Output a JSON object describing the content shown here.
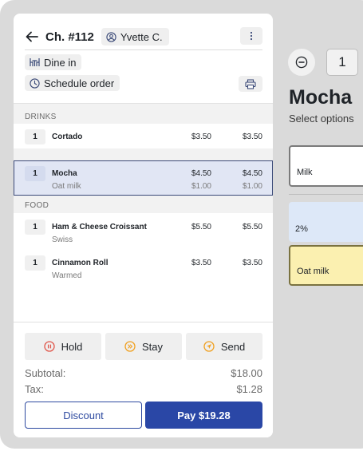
{
  "order": {
    "title": "Ch. #112",
    "customer": "Yvette C.",
    "dine_in": "Dine in",
    "schedule": "Schedule order",
    "sections": {
      "drinks": "DRINKS",
      "food": "FOOD"
    },
    "items": [
      {
        "qty": "1",
        "name": "Cortado",
        "price": "$3.50",
        "total": "$3.50"
      },
      {
        "qty": "1",
        "name": "Mocha",
        "price": "$4.50",
        "total": "$4.50",
        "mod": "Oat milk",
        "mod_price": "$1.00",
        "mod_total": "$1.00"
      },
      {
        "qty": "1",
        "name": "Ham & Cheese Croissant",
        "price": "$5.50",
        "total": "$5.50",
        "mod": "Swiss"
      },
      {
        "qty": "1",
        "name": "Cinnamon Roll",
        "price": "$3.50",
        "total": "$3.50",
        "mod": "Warmed"
      }
    ],
    "actions": {
      "hold": "Hold",
      "stay": "Stay",
      "send": "Send"
    },
    "subtotal_label": "Subtotal:",
    "subtotal": "$18.00",
    "tax_label": "Tax:",
    "tax": "$1.28",
    "discount": "Discount",
    "pay": "Pay $19.28"
  },
  "detail": {
    "quantity": "1",
    "title": "Mocha",
    "subtitle": "Select options",
    "options": [
      {
        "label": "Milk"
      },
      {
        "label": "2%"
      },
      {
        "label": "Oat milk"
      }
    ]
  },
  "colors": {
    "primary": "#2a47a6",
    "selected_row": "#e1e6f4",
    "hold": "#e0564a",
    "stay": "#f0a020",
    "send": "#f0a020",
    "option_blue": "#dde8f8",
    "option_yellow": "#fbf0b0"
  },
  "icons": [
    "back-arrow-icon",
    "user-icon",
    "kebab-icon",
    "table-icon",
    "clock-icon",
    "printer-icon",
    "pause-icon",
    "fast-forward-icon",
    "send-icon",
    "minus-icon"
  ]
}
